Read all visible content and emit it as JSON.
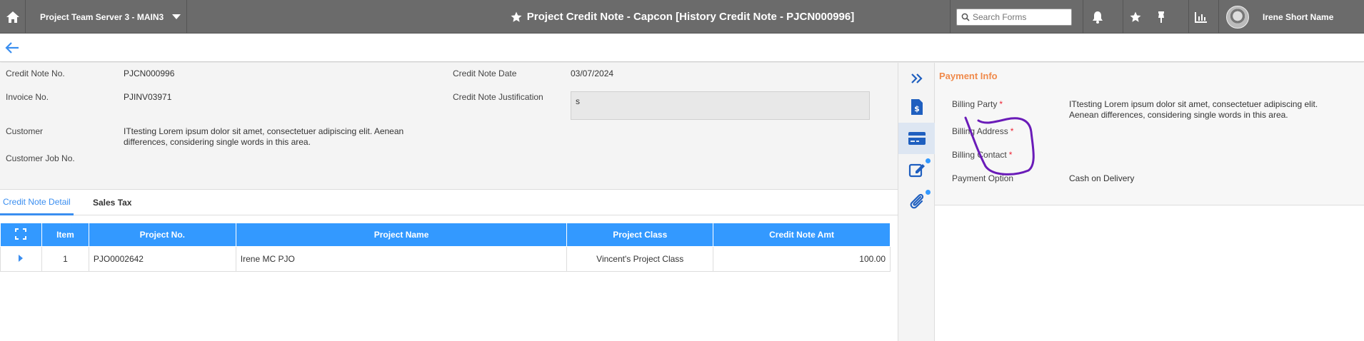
{
  "topbar": {
    "project_selector": "Project Team Server 3 - MAIN3",
    "title": "Project Credit Note - Capcon [History Credit Note - PJCN000996]",
    "search_placeholder": "Search Forms",
    "user_name": "Irene Short Name"
  },
  "form": {
    "credit_note_no_label": "Credit Note No.",
    "credit_note_no": "PJCN000996",
    "invoice_no_label": "Invoice No.",
    "invoice_no": "PJINV03971",
    "customer_label": "Customer",
    "customer_line1": "ITtesting Lorem ipsum dolor sit amet, consectetuer adipiscing elit. Aenean",
    "customer_line2": "differences, considering single words in this area.",
    "customer_job_no_label": "Customer Job No.",
    "credit_note_date_label": "Credit Note Date",
    "credit_note_date": "03/07/2024",
    "justification_label": "Credit Note Justification",
    "justification": "s"
  },
  "tabs": [
    {
      "label": "Credit Note Detail",
      "active": true
    },
    {
      "label": "Sales Tax",
      "active": false
    }
  ],
  "table": {
    "columns": [
      "Item",
      "Project No.",
      "Project Name",
      "Project Class",
      "Credit Note Amt"
    ],
    "rows": [
      {
        "item": "1",
        "project_no": "PJO0002642",
        "project_name": "Irene MC PJO",
        "project_class": "Vincent's Project Class",
        "amount": "100.00"
      }
    ]
  },
  "payment": {
    "title": "Payment Info",
    "billing_party_label": "Billing Party",
    "billing_party_line1": "ITtesting Lorem ipsum dolor sit amet, consectetuer adipiscing elit.",
    "billing_party_line2": "Aenean differences, considering single words in this area.",
    "billing_address_label": "Billing Address",
    "billing_contact_label": "Billing Contact",
    "payment_option_label": "Payment Option",
    "payment_option": "Cash on Delivery",
    "required_mark": "*"
  },
  "colors": {
    "topbar": "#6b6b6b",
    "accent": "#3399ff",
    "panel_title": "#f08a4b",
    "annotation": "#6a1bb8"
  }
}
